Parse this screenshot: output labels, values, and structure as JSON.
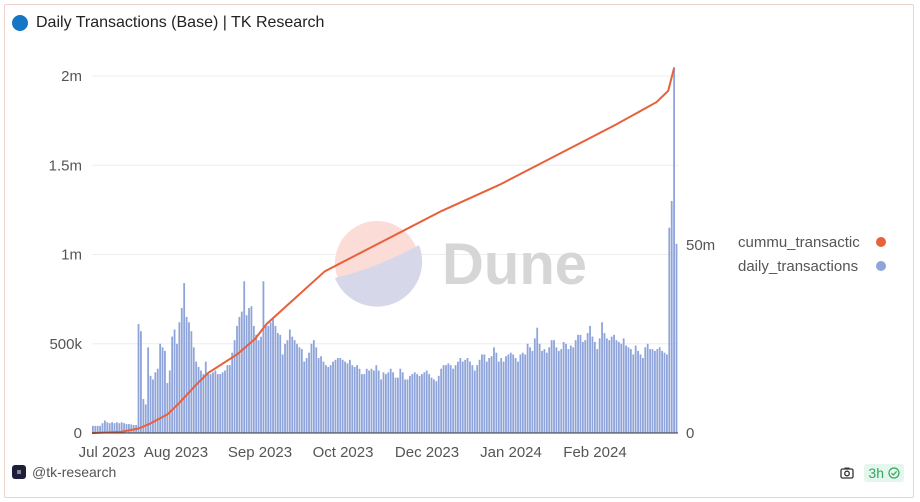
{
  "header": {
    "title": "Daily Transactions (Base) | TK Research",
    "title_dot_color": "#1576c6"
  },
  "footer": {
    "author": "@tk-research",
    "refresh_badge": "3h",
    "icons": [
      "camera-icon",
      "check-circle-icon"
    ]
  },
  "watermark": {
    "text": "Dune"
  },
  "legend": [
    {
      "label": "cummu_transactic",
      "full_name": "cummu_transactions",
      "color": "#e8603c"
    },
    {
      "label": "daily_transactions",
      "color": "#8ea4db"
    }
  ],
  "chart_data": {
    "type": "bar+line",
    "title": "Daily Transactions (Base) | TK Research",
    "x_tick_labels": [
      "Jul 2023",
      "Aug 2023",
      "Sep 2023",
      "Oct 2023",
      "Dec 2023",
      "Jan 2024",
      "Feb 2024"
    ],
    "left_axis": {
      "ticks": [
        "0",
        "500k",
        "1m",
        "1.5m",
        "2m"
      ],
      "tick_values": [
        0,
        500000,
        1000000,
        1500000,
        2000000
      ],
      "range": [
        0,
        2000000
      ]
    },
    "right_axis": {
      "ticks": [
        "0",
        "50m"
      ],
      "tick_values": [
        0,
        50000000
      ],
      "range": [
        0,
        100000000
      ]
    },
    "grid": true,
    "legend_position": "right",
    "series": [
      {
        "name": "daily_transactions",
        "type": "bar",
        "axis": "left",
        "unit": "thousands",
        "values": [
          40,
          40,
          40,
          40,
          55,
          70,
          60,
          55,
          60,
          55,
          60,
          55,
          60,
          55,
          50,
          50,
          48,
          45,
          45,
          610,
          570,
          190,
          160,
          480,
          320,
          300,
          340,
          360,
          500,
          480,
          460,
          280,
          350,
          540,
          580,
          500,
          620,
          700,
          840,
          650,
          620,
          570,
          480,
          400,
          370,
          350,
          330,
          400,
          330,
          330,
          340,
          350,
          330,
          330,
          340,
          350,
          380,
          380,
          450,
          520,
          600,
          650,
          680,
          850,
          660,
          700,
          710,
          600,
          550,
          520,
          540,
          850,
          600,
          600,
          620,
          640,
          600,
          560,
          550,
          440,
          500,
          520,
          580,
          540,
          520,
          500,
          480,
          470,
          400,
          420,
          450,
          500,
          520,
          480,
          420,
          430,
          400,
          380,
          370,
          380,
          400,
          410,
          420,
          420,
          410,
          400,
          390,
          410,
          380,
          370,
          380,
          360,
          330,
          330,
          360,
          350,
          360,
          350,
          380,
          350,
          300,
          340,
          330,
          340,
          360,
          340,
          310,
          310,
          360,
          340,
          300,
          300,
          320,
          330,
          340,
          330,
          320,
          330,
          340,
          350,
          330,
          310,
          300,
          290,
          320,
          360,
          380,
          380,
          390,
          380,
          360,
          380,
          400,
          420,
          400,
          410,
          420,
          400,
          380,
          350,
          380,
          410,
          440,
          440,
          400,
          420,
          430,
          480,
          450,
          400,
          420,
          400,
          430,
          440,
          450,
          440,
          420,
          400,
          440,
          450,
          440,
          500,
          480,
          460,
          530,
          590,
          500,
          460,
          470,
          450,
          480,
          520,
          520,
          480,
          460,
          470,
          510,
          500,
          470,
          490,
          480,
          520,
          550,
          550,
          510,
          520,
          560,
          600,
          540,
          510,
          470,
          530,
          620,
          560,
          530,
          520,
          540,
          550,
          520,
          510,
          500,
          530,
          490,
          480,
          470,
          440,
          490,
          460,
          440,
          420,
          480,
          500,
          470,
          470,
          460,
          470,
          480,
          460,
          450,
          440,
          1150,
          1300,
          2050,
          1060
        ]
      },
      {
        "name": "cummu_transactions",
        "type": "line",
        "axis": "right",
        "unit": "millions",
        "points": [
          [
            0,
            0
          ],
          [
            0.05,
            0.3
          ],
          [
            0.08,
            1.2
          ],
          [
            0.1,
            2.5
          ],
          [
            0.13,
            5
          ],
          [
            0.15,
            8
          ],
          [
            0.18,
            13
          ],
          [
            0.2,
            16
          ],
          [
            0.25,
            21
          ],
          [
            0.28,
            25
          ],
          [
            0.3,
            29
          ],
          [
            0.35,
            36
          ],
          [
            0.4,
            43
          ],
          [
            0.45,
            47
          ],
          [
            0.5,
            51
          ],
          [
            0.55,
            55
          ],
          [
            0.6,
            59
          ],
          [
            0.7,
            66
          ],
          [
            0.8,
            74
          ],
          [
            0.9,
            82
          ],
          [
            0.97,
            88
          ],
          [
            0.99,
            91
          ],
          [
            1.0,
            97
          ]
        ]
      }
    ]
  }
}
